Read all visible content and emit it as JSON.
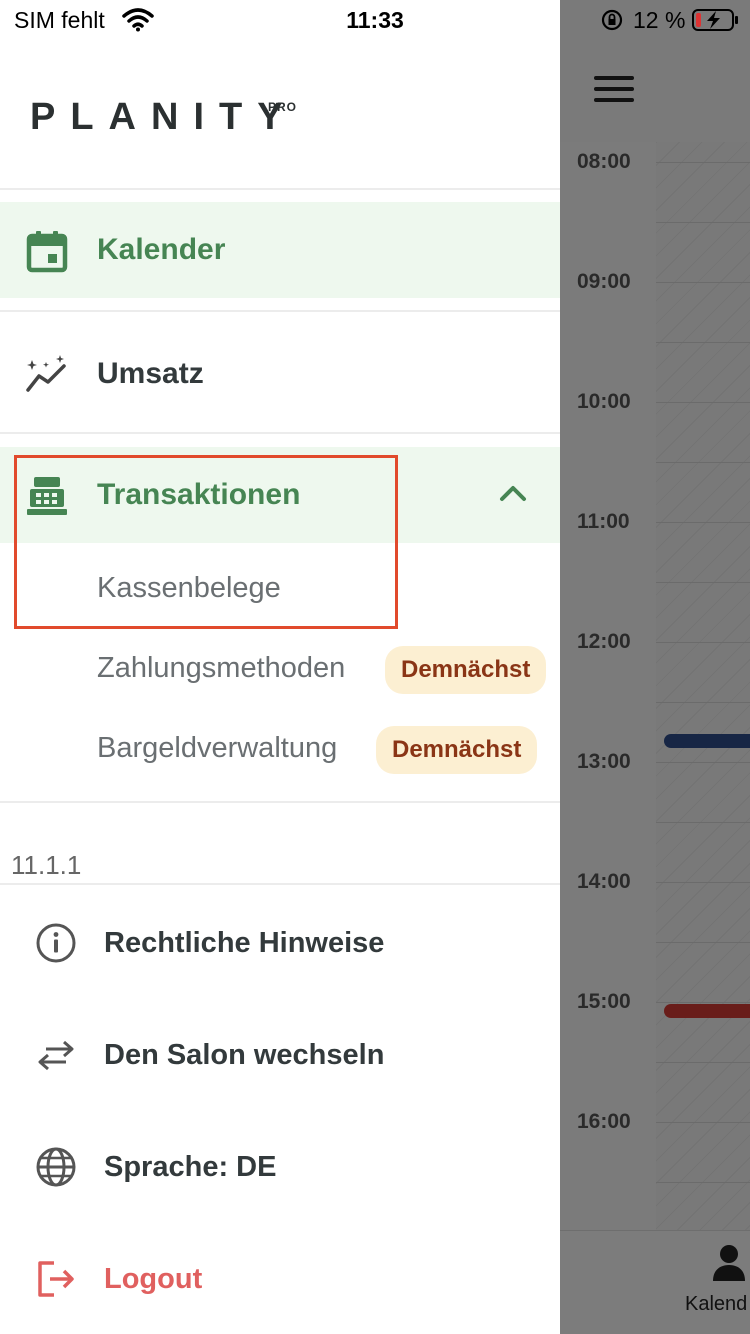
{
  "status_bar": {
    "carrier": "SIM fehlt",
    "time": "11:33",
    "battery": "12 %"
  },
  "brand": {
    "name": "PLANITY",
    "tier": "PRO"
  },
  "menu": {
    "kalender": "Kalender",
    "umsatz": "Umsatz",
    "transaktionen": "Transaktionen",
    "submenu": {
      "kassenbelege": "Kassenbelege",
      "zahlungsmethoden": "Zahlungsmethoden",
      "bargeldverwaltung": "Bargeldverwaltung",
      "badge": "Demnächst"
    }
  },
  "version": "11.1.1",
  "footer": {
    "legal": "Rechtliche Hinweise",
    "switch_salon": "Den Salon wechseln",
    "language": "Sprache: DE",
    "logout": "Logout"
  },
  "background": {
    "times": [
      "08:00",
      "09:00",
      "10:00",
      "11:00",
      "12:00",
      "13:00",
      "14:00",
      "15:00",
      "16:00"
    ],
    "tab_label": "Kalend"
  },
  "colors": {
    "accent_green": "#468553",
    "active_bg": "#eef8ee",
    "badge_bg": "#fcefd2",
    "badge_text": "#8a3516",
    "logout_red": "#e0605f",
    "highlight_border": "#e14a2c"
  }
}
